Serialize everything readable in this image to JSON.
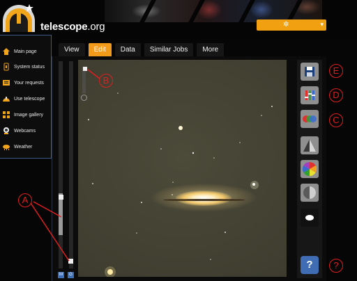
{
  "header": {
    "brand_name": "telescope",
    "brand_tld": ".org"
  },
  "tabs": [
    "View",
    "Edit",
    "Data",
    "Similar Jobs",
    "More"
  ],
  "active_tab": "Edit",
  "menu": [
    {
      "label": "Main page",
      "icon": "house-icon"
    },
    {
      "label": "System status",
      "icon": "status-icon"
    },
    {
      "label": "Your requests",
      "icon": "requests-icon"
    },
    {
      "label": "Use telescope",
      "icon": "telescope-icon"
    },
    {
      "label": "Image gallery",
      "icon": "gallery-icon"
    },
    {
      "label": "Webcams",
      "icon": "webcam-icon"
    },
    {
      "label": "Weather",
      "icon": "weather-icon"
    }
  ],
  "slider_buttons": {
    "m": "M",
    "g": "G"
  },
  "tools": [
    {
      "name": "save-tool-button",
      "icon": "floppy-disk-icon"
    },
    {
      "name": "levels-tool-button",
      "icon": "rgb-levels-icon"
    },
    {
      "name": "color-balance-tool-button",
      "icon": "rgb-circles-icon"
    },
    {
      "name": "sharpen-tool-button",
      "icon": "triangle-split-icon"
    },
    {
      "name": "color-wheel-tool-button",
      "icon": "color-wheel-icon"
    },
    {
      "name": "grayscale-tool-button",
      "icon": "gray-sphere-icon"
    },
    {
      "name": "blob-tool-button",
      "icon": "white-blob-icon"
    }
  ],
  "help_label": "?",
  "annotations": [
    "A",
    "B",
    "C",
    "D",
    "E",
    "?"
  ],
  "colors": {
    "accent": "#f29a1a",
    "annotation": "#e01f1f",
    "help": "#3f6cb2"
  }
}
